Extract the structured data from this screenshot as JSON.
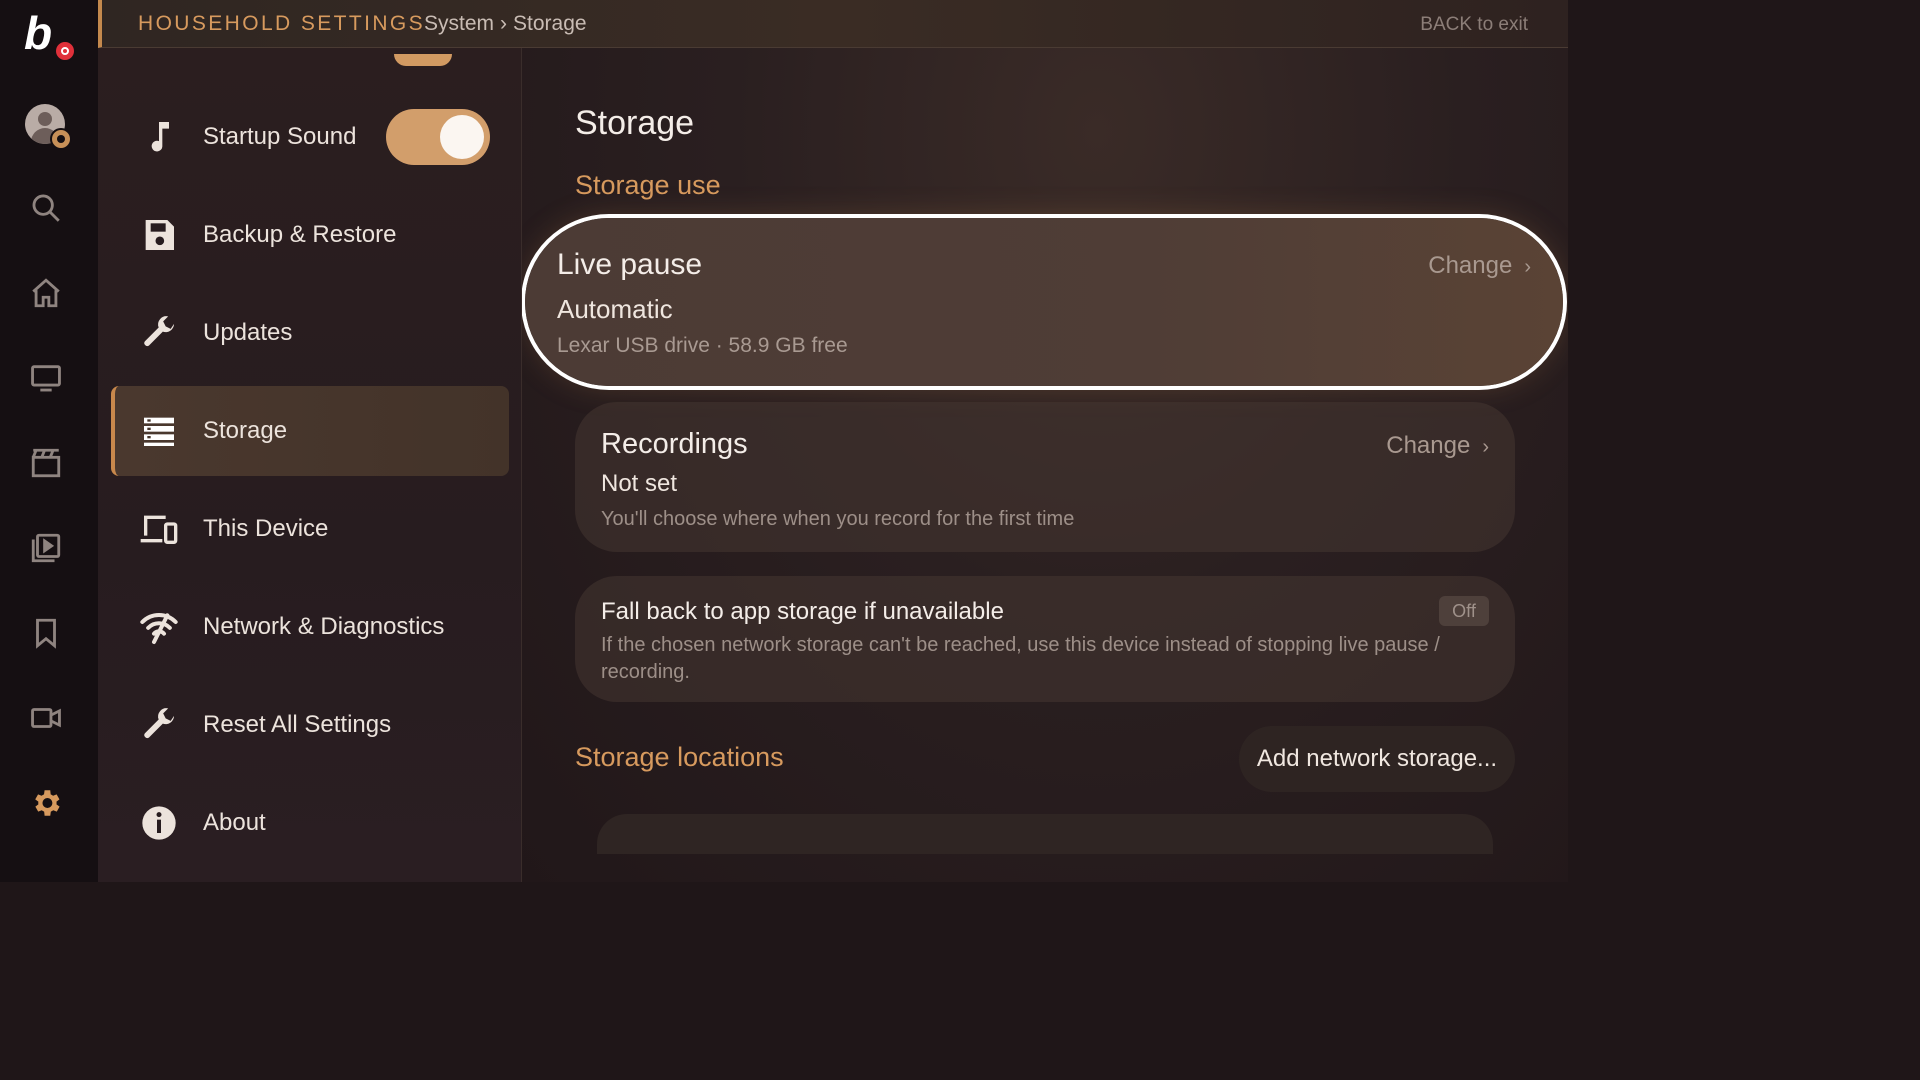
{
  "colors": {
    "accent": "#d79a5e",
    "focus_ring": "#ffffff",
    "toggle_on": "#d29e6b"
  },
  "rail": {
    "logo_letter": "b",
    "icons": [
      "profile-icon",
      "search-icon",
      "home-icon",
      "tv-icon",
      "movies-icon",
      "library-icon",
      "bookmark-icon",
      "recordings-icon",
      "settings-icon"
    ]
  },
  "header": {
    "title": "HOUSEHOLD SETTINGS",
    "breadcrumb": [
      "System",
      "›",
      "Storage"
    ],
    "back": "BACK to exit"
  },
  "sidebar": {
    "items": [
      {
        "label": "Startup Sound",
        "icon": "music-note-icon",
        "toggle": "on"
      },
      {
        "label": "Backup & Restore",
        "icon": "save-icon"
      },
      {
        "label": "Updates",
        "icon": "wrench-icon"
      },
      {
        "label": "Storage",
        "icon": "storage-icon",
        "selected": true
      },
      {
        "label": "This Device",
        "icon": "devices-icon"
      },
      {
        "label": "Network & Diagnostics",
        "icon": "network-icon"
      },
      {
        "label": "Reset All Settings",
        "icon": "wrench-icon"
      },
      {
        "label": "About",
        "icon": "info-icon"
      }
    ]
  },
  "main": {
    "title": "Storage",
    "storage_use_label": "Storage use",
    "live_pause": {
      "title": "Live pause",
      "value": "Automatic",
      "sub": "Lexar USB drive · 58.9 GB free",
      "action": "Change",
      "chevron": "›"
    },
    "recordings": {
      "title": "Recordings",
      "value": "Not set",
      "sub": "You'll choose where when you record for the first time",
      "action": "Change",
      "chevron": "›"
    },
    "fallback": {
      "title": "Fall back to app storage if unavailable",
      "sub": "If the chosen network storage can't be reached, use this device instead of stopping live pause / recording.",
      "state": "Off"
    },
    "locations_label": "Storage locations",
    "add_button": "Add network storage..."
  }
}
